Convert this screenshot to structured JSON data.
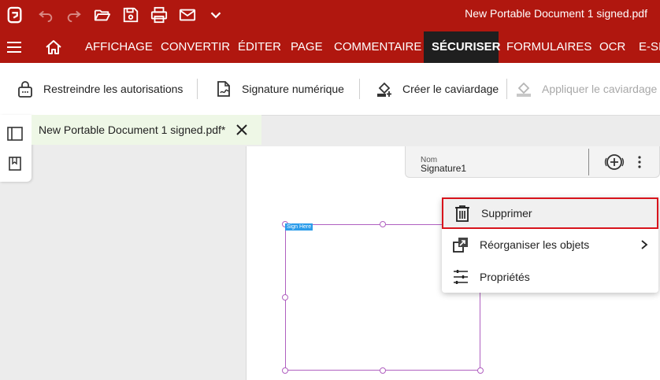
{
  "title_bar": {
    "document_title": "New Portable Document 1 signed.pdf",
    "icons": [
      "app-logo-icon",
      "undo-icon",
      "redo-icon",
      "open-folder-icon",
      "save-icon",
      "print-icon",
      "email-icon",
      "customize-chevron-icon"
    ]
  },
  "menu": {
    "tabs": [
      {
        "label": "AFFICHAGE"
      },
      {
        "label": "CONVERTIR"
      },
      {
        "label": "ÉDITER"
      },
      {
        "label": "PAGE"
      },
      {
        "label": "COMMENTAIRE"
      },
      {
        "label": "SÉCURISER",
        "active": true
      },
      {
        "label": "FORMULAIRES"
      },
      {
        "label": "OCR"
      },
      {
        "label": "E-SIGN"
      }
    ]
  },
  "ribbon": {
    "items": [
      {
        "label": "Restreindre les autorisations",
        "icon": "lock-icon"
      },
      {
        "label": "Signature numérique",
        "icon": "digital-signature-icon"
      },
      {
        "label": "Créer le caviardage",
        "icon": "redaction-create-icon"
      },
      {
        "label": "Appliquer le caviardage",
        "icon": "redaction-apply-icon",
        "disabled": true
      }
    ]
  },
  "document_tab": {
    "label": "New Portable Document 1 signed.pdf*"
  },
  "field_header": {
    "name_label": "Nom",
    "name_value": "Signature1"
  },
  "signature_field": {
    "badge": "Sign Here"
  },
  "context_menu": {
    "items": [
      {
        "label": "Supprimer",
        "icon": "trash-icon",
        "highlighted": true
      },
      {
        "label": "Réorganiser les objets",
        "icon": "arrange-icon",
        "submenu": true
      },
      {
        "label": "Propriétés",
        "icon": "sliders-icon"
      }
    ]
  },
  "colors": {
    "brand_red": "#b0170f",
    "active_tab": "#1f1f1f",
    "highlight_border": "#d8141c",
    "signature_border": "#b060c0",
    "badge_blue": "#2b9cea"
  }
}
